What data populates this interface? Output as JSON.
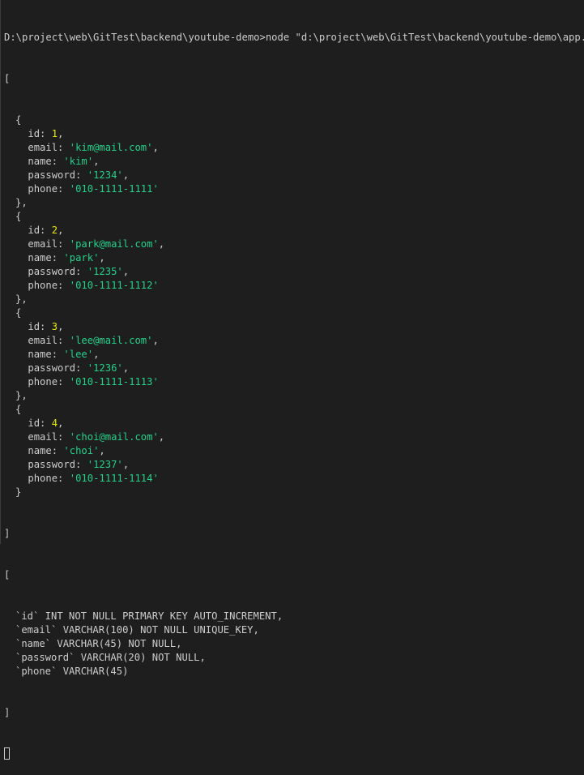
{
  "terminal": {
    "command": "D:\\project\\web\\GitTest\\backend\\youtube-demo>node \"d:\\project\\web\\GitTest\\backend\\youtube-demo\\app.js\"",
    "users_open": "[",
    "users_close": "]",
    "object_open": "{",
    "object_close": "},",
    "object_close_last": "}",
    "keys": {
      "id": "id: ",
      "email": "email: ",
      "name": "name: ",
      "password": "password: ",
      "phone": "phone: "
    },
    "comma": ",",
    "users": [
      {
        "id": "1",
        "email": "'kim@mail.com'",
        "name": "'kim'",
        "password": "'1234'",
        "phone": "'010-1111-1111'"
      },
      {
        "id": "2",
        "email": "'park@mail.com'",
        "name": "'park'",
        "password": "'1235'",
        "phone": "'010-1111-1112'"
      },
      {
        "id": "3",
        "email": "'lee@mail.com'",
        "name": "'lee'",
        "password": "'1236'",
        "phone": "'010-1111-1113'"
      },
      {
        "id": "4",
        "email": "'choi@mail.com'",
        "name": "'choi'",
        "password": "'1237'",
        "phone": "'010-1111-1114'"
      }
    ],
    "schema_open": "[",
    "schema_lines": [
      "`id` INT NOT NULL PRIMARY KEY AUTO_INCREMENT,",
      "`email` VARCHAR(100) NOT NULL UNIQUE_KEY,",
      "`name` VARCHAR(45) NOT NULL,",
      "`password` VARCHAR(20) NOT NULL,",
      "`phone` VARCHAR(45)"
    ],
    "schema_close": "]"
  }
}
